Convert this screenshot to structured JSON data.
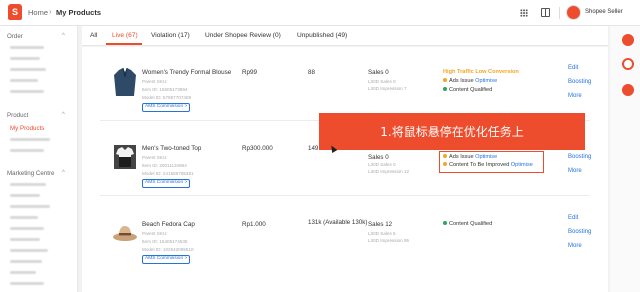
{
  "header": {
    "breadcrumb_home": "Home",
    "breadcrumb_sep": "›",
    "breadcrumb_page": "My Products",
    "seller_name": "Shopee Seller"
  },
  "sidebar": {
    "sections": [
      {
        "label": "Order",
        "chevron": "^"
      },
      {
        "label": "Product",
        "chevron": "^"
      },
      {
        "label": "Marketing Centre",
        "chevron": "^"
      }
    ],
    "active_item": "My Products"
  },
  "tabs": [
    {
      "label": "All"
    },
    {
      "label": "Live (67)",
      "active": true
    },
    {
      "label": "Violation (17)"
    },
    {
      "label": "Under Shopee Review (0)"
    },
    {
      "label": "Unpublished (49)"
    }
  ],
  "products": [
    {
      "name": "Women's Trendy Formal Blouse",
      "parent_sku": "Parent SKU:",
      "item_id": "Item ID: 15506173994",
      "model_id": "Model ID: 57897707408",
      "ams": "AMS Commission >",
      "price": "Rp99",
      "stock": "88",
      "sales": "Sales 0",
      "views": "L30D Sales 0",
      "impressions": "L30D Impression 7",
      "perf": [
        {
          "type": "highlight",
          "text": "High Traffic Low Conversion"
        },
        {
          "type": "orange",
          "text": "Ads Issue",
          "link": "Optimise"
        },
        {
          "type": "green",
          "text": "Content Qualified"
        }
      ],
      "actions": [
        "Edit",
        "Boosting",
        "More"
      ]
    },
    {
      "name": "Men's Two-toned Top",
      "parent_sku": "Parent SKU:",
      "item_id": "Item ID: 20011134964",
      "model_id": "Model ID: 241586755381",
      "ams": "AMS Commission >",
      "price": "Rp300.000",
      "stock": "149",
      "sales": "Sales 0",
      "views": "L30D Sales 0",
      "impressions": "L30D Impression 12",
      "perf": [
        {
          "type": "orange",
          "text": "Ads Issue",
          "link": "Optimise"
        },
        {
          "type": "orange",
          "text": "Content To Be Improved",
          "link": "Optimise"
        }
      ],
      "actions": [
        "Edit",
        "Boosting",
        "More"
      ]
    },
    {
      "name": "Beach Fedora Cap",
      "parent_sku": "Parent SKU:",
      "item_id": "Item ID: 15406174535",
      "model_id": "Model ID: 102542085510",
      "ams": "AMS Commission >",
      "price": "Rp1.000",
      "stock": "131k (Available 130k)",
      "sales": "Sales 12",
      "views": "L30D Sales 5",
      "impressions": "L30D Impression 95",
      "perf": [
        {
          "type": "green",
          "text": "Content Qualified"
        }
      ],
      "actions": [
        "Edit",
        "Boosting",
        "More"
      ]
    }
  ],
  "banner_text": "1.将鼠标悬停在优化任务上",
  "colors": {
    "brand": "#ee4d2d",
    "link": "#2673dd",
    "ok": "#26aa5a",
    "warn": "#f5a623"
  }
}
